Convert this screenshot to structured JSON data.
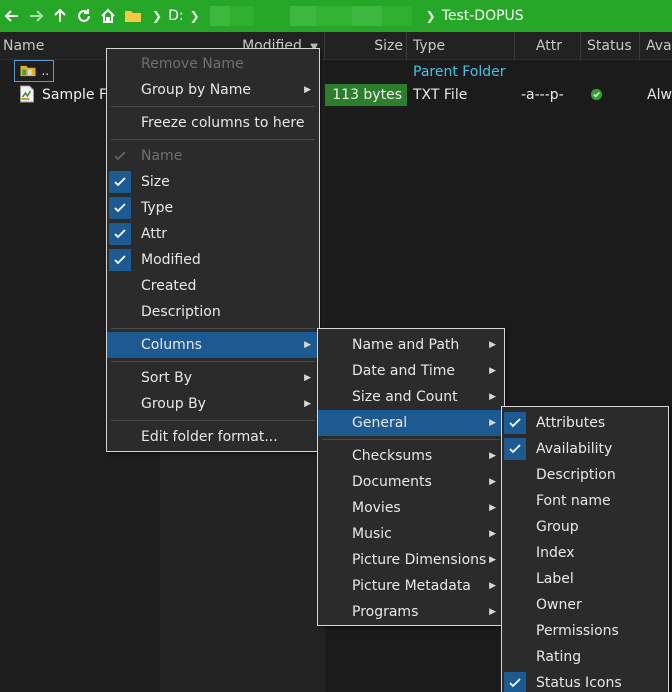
{
  "pathbar": {
    "drive": "D:",
    "current_folder": "Test-DOPUS",
    "accent_color": "#27a727"
  },
  "columns": {
    "name": "Name",
    "modified": "Modified",
    "size": "Size",
    "type": "Type",
    "attr": "Attr",
    "status": "Status",
    "availability": "Ava"
  },
  "files": [
    {
      "name": "..",
      "type": "Parent Folder",
      "icon": "parent-folder-icon"
    },
    {
      "name": "Sample Fi",
      "size": "113 bytes",
      "type": "TXT File",
      "attr": "-a---p-",
      "status_icon": "green-check-icon",
      "availability": "Alw",
      "icon": "text-file-icon"
    }
  ],
  "context_menu": {
    "remove_name": "Remove Name",
    "group_by_name": "Group by Name",
    "freeze_columns": "Freeze columns to here",
    "name": "Name",
    "size": "Size",
    "type": "Type",
    "attr": "Attr",
    "modified": "Modified",
    "created": "Created",
    "description": "Description",
    "columns": "Columns",
    "sort_by": "Sort By",
    "group_by": "Group By",
    "edit_folder_format": "Edit folder format..."
  },
  "columns_submenu": {
    "name_and_path": "Name and Path",
    "date_and_time": "Date and Time",
    "size_and_count": "Size and Count",
    "general": "General",
    "checksums": "Checksums",
    "documents": "Documents",
    "movies": "Movies",
    "music": "Music",
    "picture_dimensions": "Picture Dimensions",
    "picture_metadata": "Picture Metadata",
    "programs": "Programs"
  },
  "general_submenu": {
    "attributes": "Attributes",
    "availability": "Availability",
    "description": "Description",
    "font_name": "Font name",
    "group": "Group",
    "index": "Index",
    "label": "Label",
    "owner": "Owner",
    "permissions": "Permissions",
    "rating": "Rating",
    "status_icons": "Status Icons"
  }
}
